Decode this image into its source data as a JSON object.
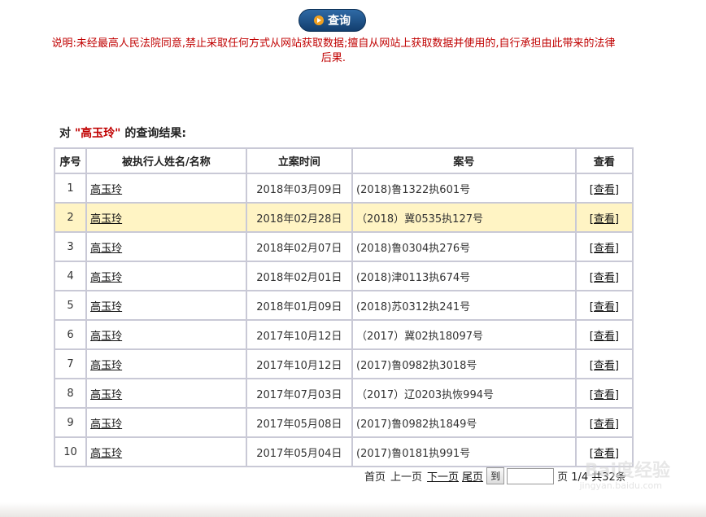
{
  "query_button": {
    "label": "查询",
    "icon": "play-arrow-icon"
  },
  "notice": "说明:未经最高人民法院同意,禁止采取任何方式从网站获取数据;擅自从网站上获取数据并使用的,自行承担由此带来的法律后果.",
  "result_title": {
    "prefix": "对",
    "keyword": "\"高玉玲\"",
    "suffix": "的查询结果:"
  },
  "table": {
    "headers": [
      "序号",
      "被执行人姓名/名称",
      "立案时间",
      "案号",
      "查看"
    ],
    "rows": [
      {
        "idx": "1",
        "name": "高玉玲",
        "date": "2018年03月09日",
        "case": "(2018)鲁1322执601号",
        "view": "[查看]"
      },
      {
        "idx": "2",
        "name": "高玉玲",
        "date": "2018年02月28日",
        "case": "（2018）冀0535执127号",
        "view": "[查看]"
      },
      {
        "idx": "3",
        "name": "高玉玲",
        "date": "2018年02月07日",
        "case": "(2018)鲁0304执276号",
        "view": "[查看]"
      },
      {
        "idx": "4",
        "name": "高玉玲",
        "date": "2018年02月01日",
        "case": "(2018)津0113执674号",
        "view": "[查看]"
      },
      {
        "idx": "5",
        "name": "高玉玲",
        "date": "2018年01月09日",
        "case": "(2018)苏0312执241号",
        "view": "[查看]"
      },
      {
        "idx": "6",
        "name": "高玉玲",
        "date": "2017年10月12日",
        "case": "（2017）冀02执18097号",
        "view": "[查看]"
      },
      {
        "idx": "7",
        "name": "高玉玲",
        "date": "2017年10月12日",
        "case": "(2017)鲁0982执3018号",
        "view": "[查看]"
      },
      {
        "idx": "8",
        "name": "高玉玲",
        "date": "2017年07月03日",
        "case": "（2017）辽0203执恢994号",
        "view": "[查看]"
      },
      {
        "idx": "9",
        "name": "高玉玲",
        "date": "2017年05月08日",
        "case": "(2017)鲁0982执1849号",
        "view": "[查看]"
      },
      {
        "idx": "10",
        "name": "高玉玲",
        "date": "2017年05月04日",
        "case": "(2017)鲁0181执991号",
        "view": "[查看]"
      }
    ],
    "highlight_row": 2
  },
  "pager": {
    "first": "首页",
    "prev": "上一页",
    "next": "下一页",
    "last": "尾页",
    "goto": "到",
    "page_input": "",
    "page_info": "页 1/4 共32条"
  },
  "watermark": {
    "text": "Bai度经验",
    "sub": "jingyan.baidu.com"
  },
  "colors": {
    "notice": "#c00000",
    "button": "#1f5490",
    "highlight_row": "#fff4c4",
    "border": "#c9c9d6"
  }
}
